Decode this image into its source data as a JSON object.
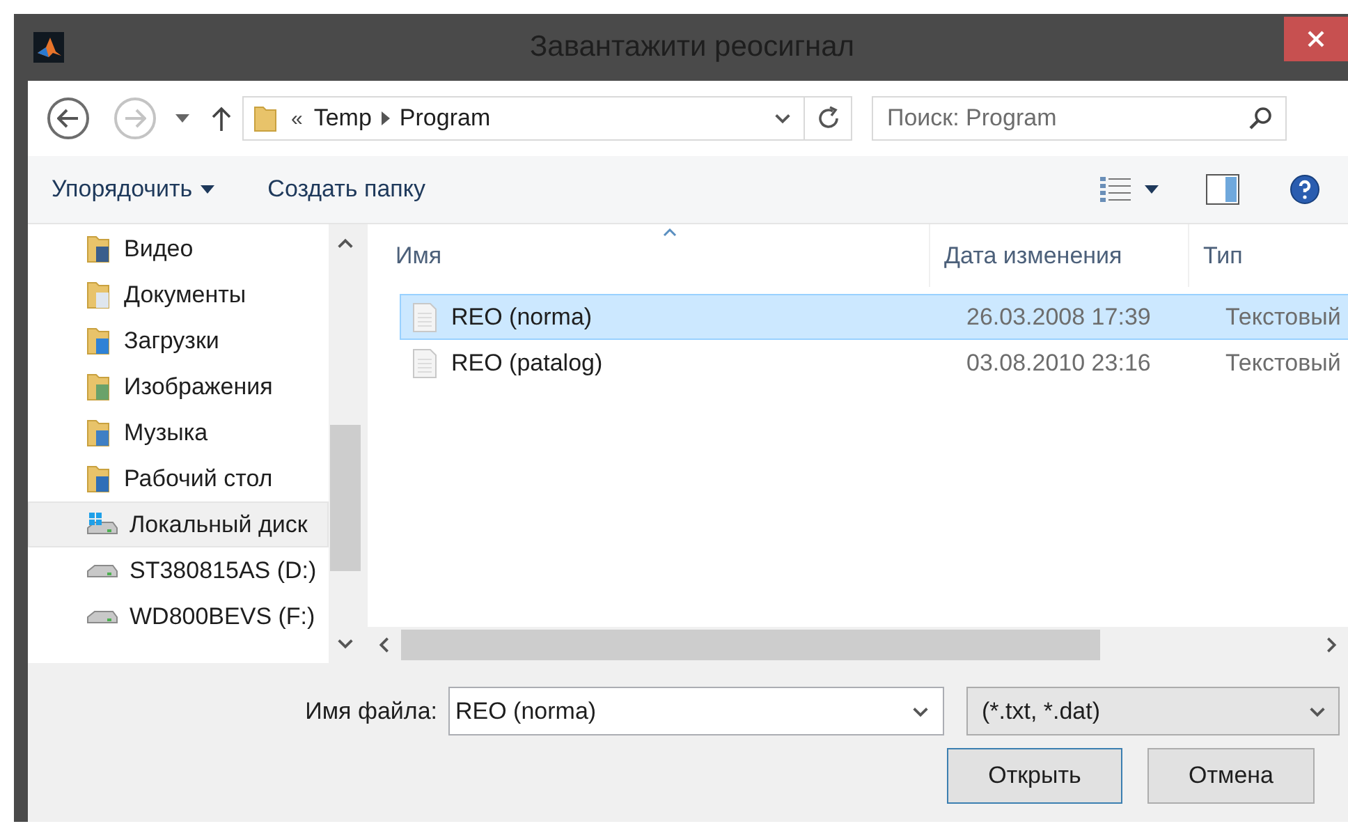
{
  "window": {
    "title": "Завантажити реосигнал"
  },
  "nav": {
    "back_enabled": true,
    "forward_enabled": false,
    "overflow": "«",
    "path": [
      "Temp",
      "Program"
    ],
    "search": {
      "placeholder": "Поиск: Program"
    }
  },
  "toolbar": {
    "organize": "Упорядочить",
    "new_folder": "Создать папку"
  },
  "sidebar": {
    "items": [
      {
        "label": "Видео",
        "kind": "video",
        "selected": false
      },
      {
        "label": "Документы",
        "kind": "documents",
        "selected": false
      },
      {
        "label": "Загрузки",
        "kind": "downloads",
        "selected": false
      },
      {
        "label": "Изображения",
        "kind": "pictures",
        "selected": false
      },
      {
        "label": "Музыка",
        "kind": "music",
        "selected": false
      },
      {
        "label": "Рабочий стол",
        "kind": "desktop",
        "selected": false
      },
      {
        "label": "Локальный диск",
        "kind": "system_drive",
        "selected": true
      },
      {
        "label": "ST380815AS (D:)",
        "kind": "drive",
        "selected": false
      },
      {
        "label": "WD800BEVS (F:)",
        "kind": "drive",
        "selected": false
      }
    ]
  },
  "files": {
    "columns": [
      "Имя",
      "Дата изменения",
      "Тип"
    ],
    "rows": [
      {
        "name": "REO (norma)",
        "date": "26.03.2008 17:39",
        "type": "Текстовый",
        "selected": true
      },
      {
        "name": "REO (patalog)",
        "date": "03.08.2010 23:16",
        "type": "Текстовый",
        "selected": false
      }
    ]
  },
  "footer": {
    "filename_label": "Имя файла:",
    "filename": "REO (norma)",
    "filter": "(*.txt, *.dat)",
    "buttons": [
      {
        "label": "Открыть",
        "default": true
      },
      {
        "label": "Отмена",
        "default": false
      }
    ]
  }
}
